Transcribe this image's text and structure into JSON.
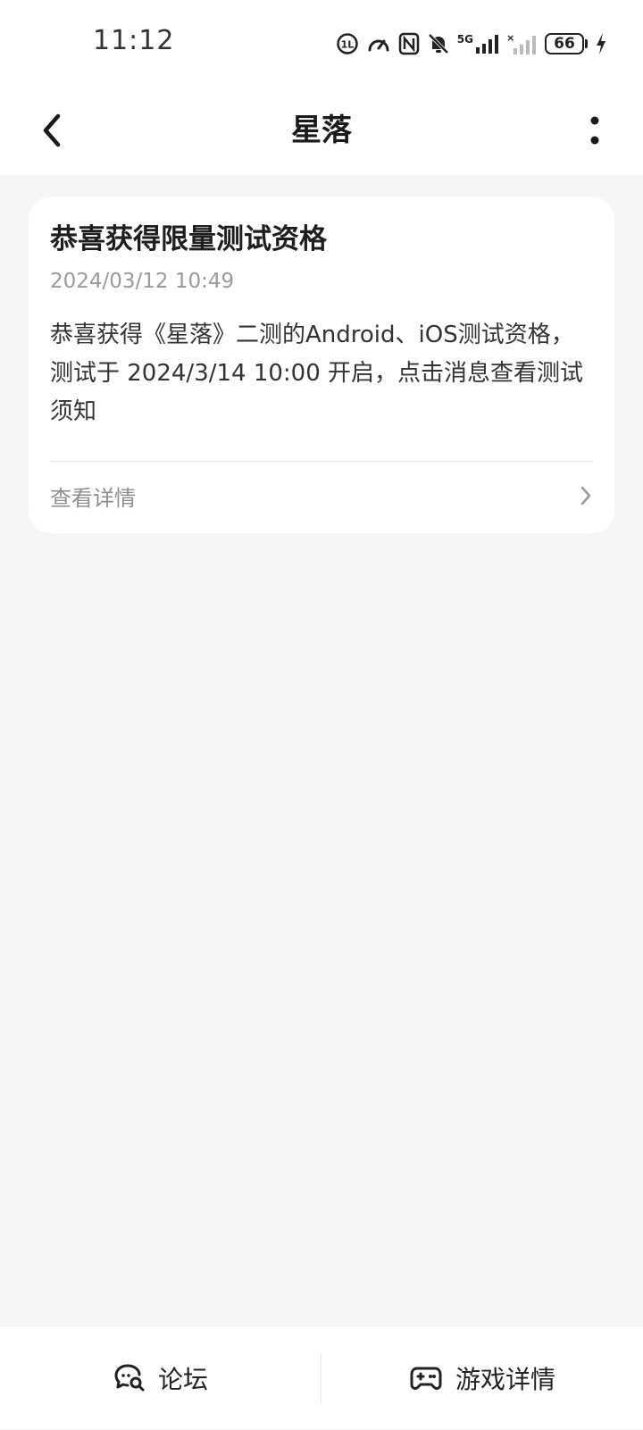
{
  "status": {
    "time": "11:12",
    "battery": "66",
    "icons": [
      "hd-call-icon",
      "speedometer-icon",
      "nfc-icon",
      "bell-off-icon",
      "signal-5g-icon",
      "signal-nosim-icon",
      "battery-icon",
      "charging-icon"
    ],
    "network_label": "5G"
  },
  "header": {
    "title": "星落",
    "back_icon": "chevron-left-icon",
    "more_icon": "more-vertical-icon"
  },
  "message": {
    "title": "恭喜获得限量测试资格",
    "timestamp": "2024/03/12 10:49",
    "body": "恭喜获得《星落》二测的Android、iOS测试资格，测试于 2024/3/14 10:00 开启，点击消息查看测试须知",
    "link_label": "查看详情"
  },
  "bottom_nav": {
    "forum_label": "论坛",
    "game_details_label": "游戏详情"
  },
  "colors": {
    "background": "#f5f6f8",
    "card": "#ffffff",
    "muted_text": "#9a9a9a"
  }
}
